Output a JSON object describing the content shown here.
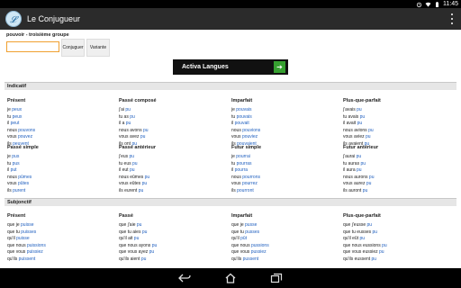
{
  "status_bar": {
    "time": "11:45"
  },
  "app": {
    "title": "Le Conjugueur"
  },
  "search": {
    "verb_label": "pouvoir - troisième groupe",
    "input_value": "",
    "conjuguer_label": "Conjuguer",
    "variante_label": "Variante"
  },
  "ad": {
    "text": "Activa Langues"
  },
  "moods": [
    {
      "name": "Indicatif",
      "tenses": [
        {
          "name": "Présent",
          "forms": [
            {
              "stem": "je ",
              "ending": "peux"
            },
            {
              "stem": "tu ",
              "ending": "peux"
            },
            {
              "stem": "il ",
              "ending": "peut"
            },
            {
              "stem": "nous ",
              "ending": "pouvons"
            },
            {
              "stem": "vous ",
              "ending": "pouvez"
            },
            {
              "stem": "ils ",
              "ending": "peuvent"
            }
          ]
        },
        {
          "name": "Passé composé",
          "forms": [
            {
              "stem": "j'ai ",
              "ending": "pu"
            },
            {
              "stem": "tu as ",
              "ending": "pu"
            },
            {
              "stem": "il a ",
              "ending": "pu"
            },
            {
              "stem": "nous avons ",
              "ending": "pu"
            },
            {
              "stem": "vous avez ",
              "ending": "pu"
            },
            {
              "stem": "ils ont ",
              "ending": "pu"
            }
          ]
        },
        {
          "name": "Imparfait",
          "forms": [
            {
              "stem": "je ",
              "ending": "pouvais"
            },
            {
              "stem": "tu ",
              "ending": "pouvais"
            },
            {
              "stem": "il ",
              "ending": "pouvait"
            },
            {
              "stem": "nous ",
              "ending": "pouvions"
            },
            {
              "stem": "vous ",
              "ending": "pouviez"
            },
            {
              "stem": "ils ",
              "ending": "pouvaient"
            }
          ]
        },
        {
          "name": "Plus-que-parfait",
          "forms": [
            {
              "stem": "j'avais ",
              "ending": "pu"
            },
            {
              "stem": "tu avais ",
              "ending": "pu"
            },
            {
              "stem": "il avait ",
              "ending": "pu"
            },
            {
              "stem": "nous avions ",
              "ending": "pu"
            },
            {
              "stem": "vous aviez ",
              "ending": "pu"
            },
            {
              "stem": "ils avaient ",
              "ending": "pu"
            }
          ]
        },
        {
          "name": "Passé simple",
          "forms": [
            {
              "stem": "je ",
              "ending": "pus"
            },
            {
              "stem": "tu ",
              "ending": "pus"
            },
            {
              "stem": "il ",
              "ending": "put"
            },
            {
              "stem": "nous ",
              "ending": "pûmes"
            },
            {
              "stem": "vous ",
              "ending": "pûtes"
            },
            {
              "stem": "ils ",
              "ending": "purent"
            }
          ]
        },
        {
          "name": "Passé antérieur",
          "forms": [
            {
              "stem": "j'eus ",
              "ending": "pu"
            },
            {
              "stem": "tu eus ",
              "ending": "pu"
            },
            {
              "stem": "il eut ",
              "ending": "pu"
            },
            {
              "stem": "nous eûmes ",
              "ending": "pu"
            },
            {
              "stem": "vous eûtes ",
              "ending": "pu"
            },
            {
              "stem": "ils eurent ",
              "ending": "pu"
            }
          ]
        },
        {
          "name": "Futur simple",
          "forms": [
            {
              "stem": "je ",
              "ending": "pourrai"
            },
            {
              "stem": "tu ",
              "ending": "pourras"
            },
            {
              "stem": "il ",
              "ending": "pourra"
            },
            {
              "stem": "nous ",
              "ending": "pourrons"
            },
            {
              "stem": "vous ",
              "ending": "pourrez"
            },
            {
              "stem": "ils ",
              "ending": "pourront"
            }
          ]
        },
        {
          "name": "Futur antérieur",
          "forms": [
            {
              "stem": "j'aurai ",
              "ending": "pu"
            },
            {
              "stem": "tu auras ",
              "ending": "pu"
            },
            {
              "stem": "il aura ",
              "ending": "pu"
            },
            {
              "stem": "nous aurons ",
              "ending": "pu"
            },
            {
              "stem": "vous aurez ",
              "ending": "pu"
            },
            {
              "stem": "ils auront ",
              "ending": "pu"
            }
          ]
        }
      ]
    },
    {
      "name": "Subjonctif",
      "tenses": [
        {
          "name": "Présent",
          "forms": [
            {
              "stem": "que je ",
              "ending": "puisse"
            },
            {
              "stem": "que tu ",
              "ending": "puisses"
            },
            {
              "stem": "qu'il ",
              "ending": "puisse"
            },
            {
              "stem": "que nous ",
              "ending": "puissions"
            },
            {
              "stem": "que vous ",
              "ending": "puissiez"
            },
            {
              "stem": "qu'ils ",
              "ending": "puissent"
            }
          ]
        },
        {
          "name": "Passé",
          "forms": [
            {
              "stem": "que j'aie ",
              "ending": "pu"
            },
            {
              "stem": "que tu aies ",
              "ending": "pu"
            },
            {
              "stem": "qu'il ait ",
              "ending": "pu"
            },
            {
              "stem": "que nous ayons ",
              "ending": "pu"
            },
            {
              "stem": "que vous ayez ",
              "ending": "pu"
            },
            {
              "stem": "qu'ils aient ",
              "ending": "pu"
            }
          ]
        },
        {
          "name": "Imparfait",
          "forms": [
            {
              "stem": "que je ",
              "ending": "pusse"
            },
            {
              "stem": "que tu ",
              "ending": "pusses"
            },
            {
              "stem": "qu'il ",
              "ending": "pût"
            },
            {
              "stem": "que nous ",
              "ending": "pussions"
            },
            {
              "stem": "que vous ",
              "ending": "pussiez"
            },
            {
              "stem": "qu'ils ",
              "ending": "pussent"
            }
          ]
        },
        {
          "name": "Plus-que-parfait",
          "forms": [
            {
              "stem": "que j'eusse ",
              "ending": "pu"
            },
            {
              "stem": "que tu eusses ",
              "ending": "pu"
            },
            {
              "stem": "qu'il eût ",
              "ending": "pu"
            },
            {
              "stem": "que nous eussions ",
              "ending": "pu"
            },
            {
              "stem": "que vous eussiez ",
              "ending": "pu"
            },
            {
              "stem": "qu'ils eussent ",
              "ending": "pu"
            }
          ]
        }
      ]
    }
  ],
  "colors": {
    "ending": "#1f5fbf",
    "action_bar": "#2b2b2b",
    "input_focus": "#f0a030",
    "ad_button": "#36a030"
  },
  "icons": [
    "app-logo-icon",
    "overflow-menu-icon",
    "back-icon",
    "home-icon",
    "recent-apps-icon",
    "alarm-icon",
    "wifi-icon",
    "battery-icon"
  ]
}
